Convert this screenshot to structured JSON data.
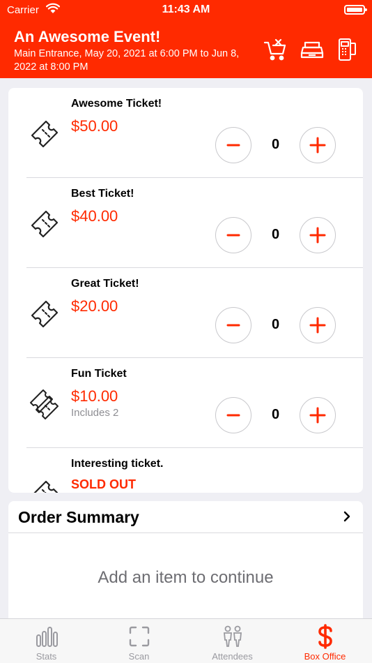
{
  "status": {
    "carrier": "Carrier",
    "time": "11:43 AM"
  },
  "header": {
    "title": "An Awesome Event!",
    "subtitle": "Main Entrance, May 20, 2021 at 6:00 PM to Jun  8, 2022 at 8:00 PM",
    "icons": [
      "cart-remove-icon",
      "cash-register-icon",
      "card-terminal-icon"
    ]
  },
  "tickets": [
    {
      "name": "Awesome Ticket!",
      "price": "$50.00",
      "note": "",
      "qty": "0"
    },
    {
      "name": "Best Ticket!",
      "price": "$40.00",
      "note": "",
      "qty": "0"
    },
    {
      "name": "Great Ticket!",
      "price": "$20.00",
      "note": "",
      "qty": "0"
    },
    {
      "name": "Fun Ticket",
      "price": "$10.00",
      "note": "Includes 2",
      "qty": "0"
    },
    {
      "name": "Interesting ticket.",
      "status": "SOLD OUT"
    }
  ],
  "summary": {
    "title": "Order Summary",
    "empty": "Add an item to continue"
  },
  "tabs": [
    {
      "label": "Stats",
      "icon": "stats-icon"
    },
    {
      "label": "Scan",
      "icon": "scan-icon"
    },
    {
      "label": "Attendees",
      "icon": "attendees-icon"
    },
    {
      "label": "Box Office",
      "icon": "dollar-icon",
      "active": true
    }
  ],
  "colors": {
    "accent": "#ff2a00",
    "background": "#efeff4",
    "muted": "#8e8e93"
  }
}
